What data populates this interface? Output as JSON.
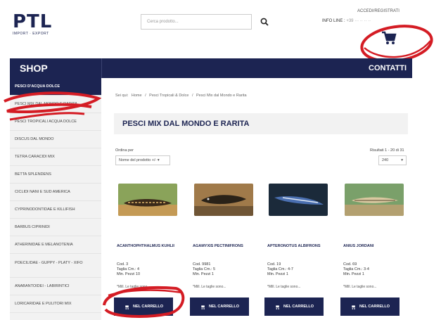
{
  "brand": {
    "logo": "PTL",
    "tagline": "IMPORT · EXPORT"
  },
  "header": {
    "search_placeholder": "Cerca prodotto...",
    "access": "ACCEDI/REGISTRATI",
    "info_line_label": "INFO LINE :",
    "info_line_number": "+39 ··· ·· ·· ··"
  },
  "nav": {
    "shop": "SHOP",
    "contacts": "CONTATTI"
  },
  "sidebar": {
    "items": [
      {
        "label": "PESCI D'ACQUA DOLCE"
      },
      {
        "label": "PESCI MIX DAL MONDO E RARITA"
      },
      {
        "label": "PESCI TROPICALI ACQUA DOLCE"
      },
      {
        "label": "DISCUS DAL MONDO"
      },
      {
        "label": "TETRA CARACIDI MIX"
      },
      {
        "label": "BETTA SPLENDENS"
      },
      {
        "label": "CICLIDI NANI E SUD AMERICA"
      },
      {
        "label": "CYPRINODONTIDAE E KILLIFISH"
      },
      {
        "label": "BARBUS CIPRINIDI"
      },
      {
        "label": "ATHERINIDAE E MELANOTENIA"
      },
      {
        "label": "POECILIDAE - GUPPY - PLATY - XIFO"
      },
      {
        "label": "ANABANTOIDEI - LABIRINTICI"
      },
      {
        "label": "LORICARIDAE E PULITORI MIX"
      }
    ]
  },
  "breadcrumb": [
    "Sei qui:",
    "Home",
    "/",
    "Pesci Tropicali & Dolce",
    "/",
    "Pesci Mix dal Mondo e Rarita"
  ],
  "page": {
    "title": "PESCI MIX DAL MONDO E RARITA",
    "sort_label": "Ordina per",
    "sort_value": "Nome del prodotto +/-",
    "results": "Risultati 1 - 20 di 31",
    "per_page": "240"
  },
  "products": [
    {
      "name": "ACANTHOPHTHALMUS KUHLII",
      "code": "Cod. 3",
      "size": "Taglia Cm.: 4",
      "min_qty": "Min. Pezzi 10",
      "note": "*Mill. Le taglie sono...",
      "cart": "NEL CARRELLO"
    },
    {
      "name": "AGAMYXIS PECTINIFRONS",
      "code": "Cod. 9981",
      "size": "Taglia Cm.: 5",
      "min_qty": "Min. Pezzi 1",
      "note": "*Mill. Le taglie sono...",
      "cart": "NEL CARRELLO"
    },
    {
      "name": "APTERONOTUS ALBIFRONS",
      "code": "Cod. 19",
      "size": "Taglia Cm.: 4-7",
      "min_qty": "Min. Pezzi 1",
      "note": "*Mill. Le taglie sono...",
      "cart": "NEL CARRELLO"
    },
    {
      "name": "ANIUS JORDANI",
      "code": "Cod. 69",
      "size": "Taglia Cm.: 3-4",
      "min_qty": "Min. Pezzi 1",
      "note": "*Mill. Le taglie sono...",
      "cart": "NEL CARRELLO"
    }
  ],
  "colors": {
    "navy": "#1c2452",
    "sidebar_bg": "#f2f2f2",
    "annotation_red": "#d41c24"
  }
}
